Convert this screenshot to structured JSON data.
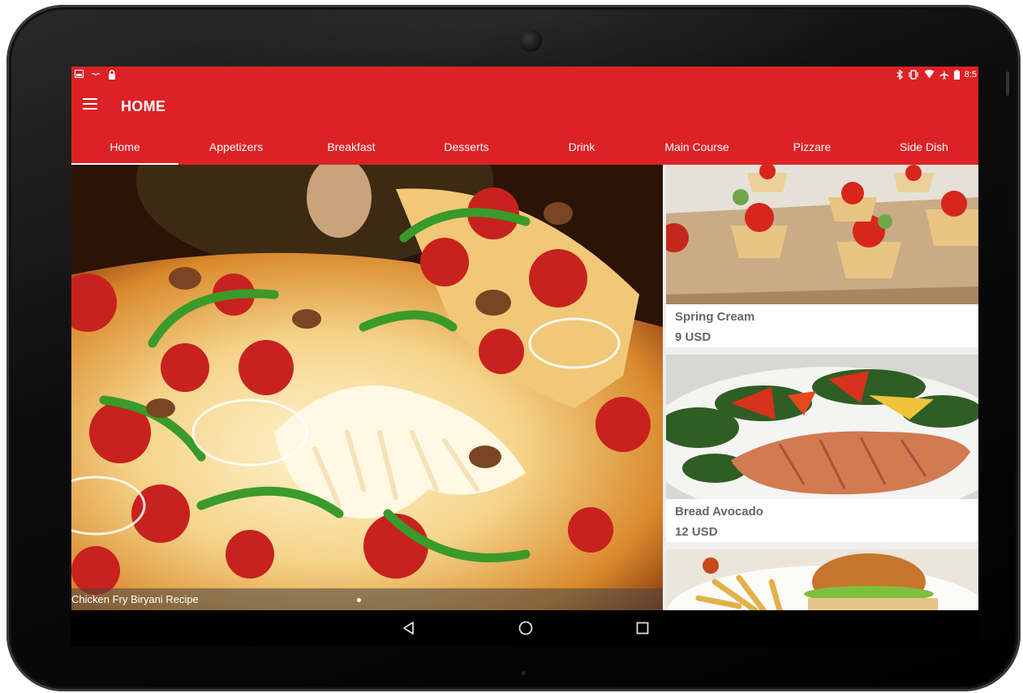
{
  "app": {
    "title": "HOME"
  },
  "status_bar": {
    "time": "8:5"
  },
  "tabs": [
    {
      "label": "Home",
      "active": true
    },
    {
      "label": "Appetizers",
      "active": false
    },
    {
      "label": "Breakfast",
      "active": false
    },
    {
      "label": "Desserts",
      "active": false
    },
    {
      "label": "Drink",
      "active": false
    },
    {
      "label": "Main Course",
      "active": false
    },
    {
      "label": "Pizzare",
      "active": false
    },
    {
      "label": "Side Dish",
      "active": false
    }
  ],
  "hero": {
    "caption": "Chicken Fry Biryani Recipe",
    "image": "pizza-photo"
  },
  "feed": [
    {
      "name": "Spring Cream",
      "price": "9 USD",
      "image": "tartlets-photo"
    },
    {
      "name": "Bread Avocado",
      "price": "12 USD",
      "image": "salmon-salad-photo"
    },
    {
      "name": "",
      "price": "",
      "image": "burger-fries-photo"
    }
  ],
  "colors": {
    "primary": "#dd2226",
    "text_secondary": "#666666"
  },
  "nav": {
    "back": "back-icon",
    "home": "home-circle-icon",
    "recents": "recents-square-icon"
  }
}
